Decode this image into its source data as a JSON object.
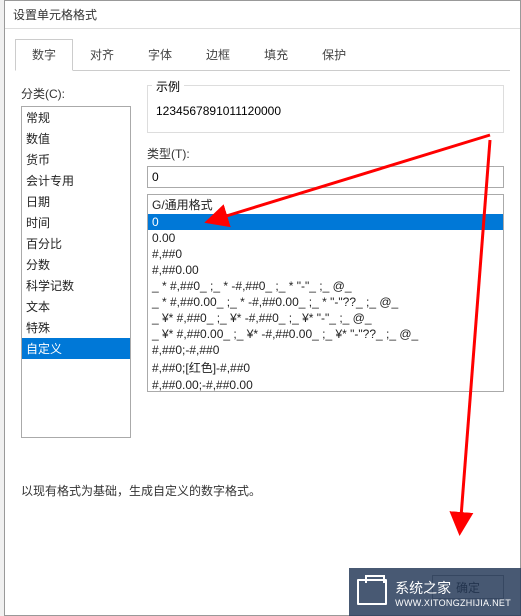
{
  "dialog": {
    "title": "设置单元格格式"
  },
  "tabs": {
    "number": "数字",
    "alignment": "对齐",
    "font": "字体",
    "border": "边框",
    "fill": "填充",
    "protection": "保护"
  },
  "category": {
    "label": "分类(C):",
    "items": [
      "常规",
      "数值",
      "货币",
      "会计专用",
      "日期",
      "时间",
      "百分比",
      "分数",
      "科学记数",
      "文本",
      "特殊",
      "自定义"
    ],
    "selected_index": 11
  },
  "sample": {
    "label": "示例",
    "value": "1234567891011120000"
  },
  "type": {
    "label": "类型(T):",
    "input_value": "0",
    "items": [
      "G/通用格式",
      "0",
      "0.00",
      "#,##0",
      "#,##0.00",
      "_ * #,##0_ ;_ * -#,##0_ ;_ * \"-\"_ ;_ @_ ",
      "_ * #,##0.00_ ;_ * -#,##0.00_ ;_ * \"-\"??_ ;_ @_ ",
      "_ ¥* #,##0_ ;_ ¥* -#,##0_ ;_ ¥* \"-\"_ ;_ @_ ",
      "_ ¥* #,##0.00_ ;_ ¥* -#,##0.00_ ;_ ¥* \"-\"??_ ;_ @_ ",
      "#,##0;-#,##0",
      "#,##0;[红色]-#,##0",
      "#,##0.00;-#,##0.00"
    ],
    "selected_index": 1
  },
  "description": "以现有格式为基础，生成自定义的数字格式。",
  "buttons": {
    "ok": "确定"
  },
  "watermark": {
    "text": "系统之家",
    "url": "WWW.XITONGZHIJIA.NET"
  }
}
